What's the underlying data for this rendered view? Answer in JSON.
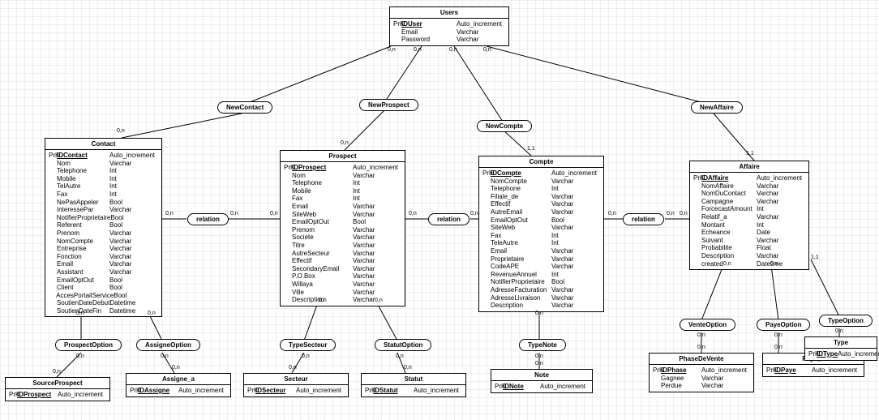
{
  "entities": {
    "users": {
      "title": "Users",
      "attrs": [
        {
          "key": "PrK",
          "name": "IDUser",
          "type": "Auto_increment",
          "pk": true
        },
        {
          "key": "",
          "name": "Email",
          "type": "Varchar"
        },
        {
          "key": "",
          "name": "Password",
          "type": "Varchar"
        }
      ]
    },
    "contact": {
      "title": "Contact",
      "attrs": [
        {
          "key": "PrK",
          "name": "IDContact",
          "type": "Auto_increment",
          "pk": true
        },
        {
          "key": "",
          "name": "Nom",
          "type": "Varchar"
        },
        {
          "key": "",
          "name": "Telephone",
          "type": "Int"
        },
        {
          "key": "",
          "name": "Mobile",
          "type": "Int"
        },
        {
          "key": "",
          "name": "TelAutre",
          "type": "Int"
        },
        {
          "key": "",
          "name": "Fax",
          "type": "Int"
        },
        {
          "key": "",
          "name": "NePasAppeler",
          "type": "Bool"
        },
        {
          "key": "",
          "name": "InteressePar",
          "type": "Varchar"
        },
        {
          "key": "",
          "name": "NotifierProprietaire",
          "type": "Bool"
        },
        {
          "key": "",
          "name": "Referent",
          "type": "Bool"
        },
        {
          "key": "",
          "name": "Prenom",
          "type": "Varchar"
        },
        {
          "key": "",
          "name": "NomCompte",
          "type": "Varchar"
        },
        {
          "key": "",
          "name": "Entreprise",
          "type": "Varchar"
        },
        {
          "key": "",
          "name": "Fonction",
          "type": "Varchar"
        },
        {
          "key": "",
          "name": "Email",
          "type": "Varchar"
        },
        {
          "key": "",
          "name": "Assistant",
          "type": "Varchar"
        },
        {
          "key": "",
          "name": "EmailOptOut",
          "type": "Bool"
        },
        {
          "key": "",
          "name": "Client",
          "type": "Bool"
        },
        {
          "key": "",
          "name": "AccesPortailService",
          "type": "Bool"
        },
        {
          "key": "",
          "name": "SoutienDateDebut",
          "type": "Datetime"
        },
        {
          "key": "",
          "name": "SoutienDateFin",
          "type": "Datetime"
        }
      ]
    },
    "prospect": {
      "title": "Prospect",
      "attrs": [
        {
          "key": "PrK",
          "name": "IDProspect",
          "type": "Auto_increment",
          "pk": true
        },
        {
          "key": "",
          "name": "Nom",
          "type": "Varchar"
        },
        {
          "key": "",
          "name": "Telephone",
          "type": "Int"
        },
        {
          "key": "",
          "name": "Mobile",
          "type": "Int"
        },
        {
          "key": "",
          "name": "Fax",
          "type": "Int"
        },
        {
          "key": "",
          "name": "Email",
          "type": "Varchar"
        },
        {
          "key": "",
          "name": "SiteWeb",
          "type": "Varchar"
        },
        {
          "key": "",
          "name": "EmailOptOut",
          "type": "Bool"
        },
        {
          "key": "",
          "name": "Prenom",
          "type": "Varchar"
        },
        {
          "key": "",
          "name": "Societe",
          "type": "Varchar"
        },
        {
          "key": "",
          "name": "Titre",
          "type": "Varchar"
        },
        {
          "key": "",
          "name": "AutreSecteur",
          "type": "Varchar"
        },
        {
          "key": "",
          "name": "Effectif",
          "type": "Varchar"
        },
        {
          "key": "",
          "name": "SecondaryEmail",
          "type": "Varchar"
        },
        {
          "key": "",
          "name": "P.O.Box",
          "type": "Varchar"
        },
        {
          "key": "",
          "name": "Willaya",
          "type": "Varchar"
        },
        {
          "key": "",
          "name": "Ville",
          "type": "Varchar"
        },
        {
          "key": "",
          "name": "Description",
          "type": "Varchar"
        }
      ]
    },
    "compte": {
      "title": "Compte",
      "attrs": [
        {
          "key": "PrK",
          "name": "IDCompte",
          "type": "Auto_increment",
          "pk": true
        },
        {
          "key": "",
          "name": "NomCompte",
          "type": "Varchar"
        },
        {
          "key": "",
          "name": "Telephone",
          "type": "Int"
        },
        {
          "key": "",
          "name": "Filiale_de",
          "type": "Varchar"
        },
        {
          "key": "",
          "name": "Effectif",
          "type": "Varchar"
        },
        {
          "key": "",
          "name": "AutreEmail",
          "type": "Varchar"
        },
        {
          "key": "",
          "name": "EmailOptOut",
          "type": "Bool"
        },
        {
          "key": "",
          "name": "SiteWeb",
          "type": "Varchar"
        },
        {
          "key": "",
          "name": "Fax",
          "type": "Int"
        },
        {
          "key": "",
          "name": "TeleAutre",
          "type": "Int"
        },
        {
          "key": "",
          "name": "Email",
          "type": "Varchar"
        },
        {
          "key": "",
          "name": "Proprietaire",
          "type": "Varchar"
        },
        {
          "key": "",
          "name": "CodeAPE",
          "type": "Varchar"
        },
        {
          "key": "",
          "name": "RevenueAnnuel",
          "type": "Int"
        },
        {
          "key": "",
          "name": "NotifierProprietaire",
          "type": "Bool"
        },
        {
          "key": "",
          "name": "AdresseFacturation",
          "type": "Varchar"
        },
        {
          "key": "",
          "name": "AdresseLivraison",
          "type": "Varchar"
        },
        {
          "key": "",
          "name": "Description",
          "type": "Varchar"
        }
      ]
    },
    "affaire": {
      "title": "Affaire",
      "attrs": [
        {
          "key": "PrK",
          "name": "IDAffaire",
          "type": "Auto_increment",
          "pk": true
        },
        {
          "key": "",
          "name": "NomAffaire",
          "type": "Varchar"
        },
        {
          "key": "",
          "name": "NomDuContact",
          "type": "Varchar"
        },
        {
          "key": "",
          "name": "Campagne",
          "type": "Varchar"
        },
        {
          "key": "",
          "name": "ForcecastAmount",
          "type": "Int"
        },
        {
          "key": "",
          "name": "Relatif_a",
          "type": "Varchar"
        },
        {
          "key": "",
          "name": "Montant",
          "type": "Int"
        },
        {
          "key": "",
          "name": "Echeance",
          "type": "Date"
        },
        {
          "key": "",
          "name": "Suivant",
          "type": "Varchar"
        },
        {
          "key": "",
          "name": "Probabilite",
          "type": "Float"
        },
        {
          "key": "",
          "name": "Description",
          "type": "Varchar"
        },
        {
          "key": "",
          "name": "created",
          "type": "Datetime"
        }
      ]
    },
    "sourceprospect": {
      "title": "SourceProspect",
      "attrs": [
        {
          "key": "PrK",
          "name": "IDProspect",
          "type": "Auto_increment",
          "pk": true
        }
      ]
    },
    "assigne_a": {
      "title": "Assigne_a",
      "attrs": [
        {
          "key": "PrK",
          "name": "IDAssigne",
          "type": "Auto_increment",
          "pk": true
        }
      ]
    },
    "secteur": {
      "title": "Secteur",
      "attrs": [
        {
          "key": "PrK",
          "name": "IDSecteur",
          "type": "Auto_increment",
          "pk": true
        }
      ]
    },
    "statut": {
      "title": "Statut",
      "attrs": [
        {
          "key": "PrK",
          "name": "IDStatut",
          "type": "Auto_increment",
          "pk": true
        }
      ]
    },
    "note": {
      "title": "Note",
      "attrs": [
        {
          "key": "PrK",
          "name": "IDNote",
          "type": "Auto_increment",
          "pk": true
        }
      ]
    },
    "phasedevente": {
      "title": "PhaseDeVente",
      "attrs": [
        {
          "key": "PrK",
          "name": "IDPhase",
          "type": "Auto_increment",
          "pk": true
        },
        {
          "key": "",
          "name": "Gagnee",
          "type": "Varchar"
        },
        {
          "key": "",
          "name": "Perdue",
          "type": "Varchar"
        }
      ]
    },
    "paye_a": {
      "title": "Paye_a",
      "attrs": [
        {
          "key": "PrK",
          "name": "IDPaye",
          "type": "Auto_increment",
          "pk": true
        }
      ]
    },
    "type": {
      "title": "Type",
      "attrs": [
        {
          "key": "PrK",
          "name": "IDType",
          "type": "Auto_increment",
          "pk": true
        }
      ]
    }
  },
  "relations": {
    "newcontact": "NewContact",
    "newprospect": "NewProspect",
    "newcompte": "NewCompte",
    "newaffaire": "NewAffaire",
    "rel_cp": "relation",
    "rel_pc": "relation",
    "rel_ca": "relation",
    "prospectoption": "ProspectOption",
    "assigneoption": "AssigneOption",
    "typesecteur": "TypeSecteur",
    "statutoption": "StatutOption",
    "typenote": "TypeNote",
    "venteoption": "VenteOption",
    "payeoption": "PayeOption",
    "typeoption": "TypeOption"
  },
  "cards": {
    "zn": "0,n",
    "on": "0,n",
    "oo": "1,1"
  }
}
